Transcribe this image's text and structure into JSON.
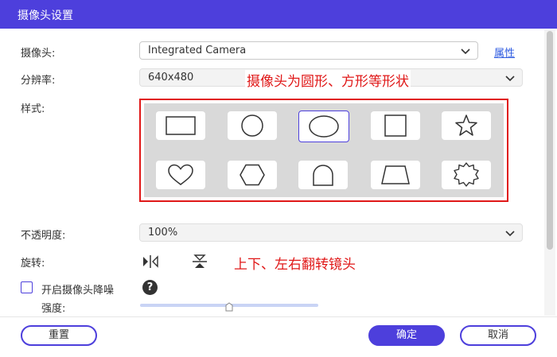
{
  "window": {
    "title": "摄像头设置"
  },
  "camera": {
    "label": "摄像头:",
    "value": "Integrated Camera",
    "properties_link": "属性"
  },
  "resolution": {
    "label": "分辨率:",
    "value": "640x480"
  },
  "style": {
    "label": "样式:",
    "annotation": "摄像头为圆形、方形等形状",
    "shapes": [
      "rectangle",
      "circle",
      "ellipse",
      "square",
      "star",
      "heart",
      "hexagon",
      "arch",
      "trapezoid",
      "badge"
    ],
    "selected": "ellipse"
  },
  "opacity": {
    "label": "不透明度:",
    "value": "100%"
  },
  "rotation": {
    "label": "旋转:",
    "annotation": "上下、左右翻转镜头"
  },
  "denoise": {
    "label": "开启摄像头降噪",
    "checked": false,
    "strength_label": "强度:",
    "strength_level_fraction": 0.5
  },
  "buttons": {
    "reset": "重置",
    "ok": "确定",
    "cancel": "取消"
  },
  "colors": {
    "accent": "#4d3fdc",
    "annotation": "#e01818",
    "link": "#2b59e0"
  }
}
